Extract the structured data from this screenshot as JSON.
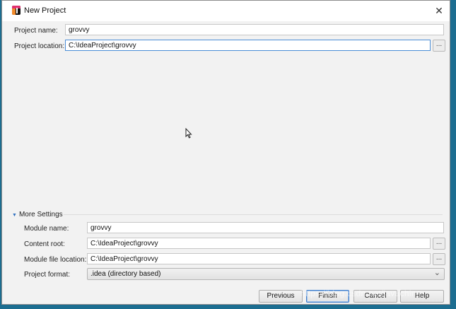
{
  "window": {
    "title": "New Project",
    "close_label": "✕"
  },
  "project": {
    "name_label": "Project name:",
    "name_value": "grovvy",
    "location_label": "Project location:",
    "location_value": "C:\\IdeaProject\\grovvy",
    "browse_label": "..."
  },
  "more_settings": {
    "header": "More Settings",
    "module_name_label": "Module name:",
    "module_name_value": "grovvy",
    "content_root_label": "Content root:",
    "content_root_value": "C:\\IdeaProject\\grovvy",
    "module_file_label": "Module file location:",
    "module_file_value": "C:\\IdeaProject\\grovvy",
    "project_format_label": "Project format:",
    "project_format_value": ".idea (directory based)",
    "browse_label": "..."
  },
  "buttons": {
    "previous": "Previous",
    "finish": "Finish",
    "cancel": "Cancel",
    "help": "Help"
  },
  "watermark": "https://blog.csdn.net/javachina",
  "icons": {
    "app": "intellij-idea-icon",
    "close": "close-icon",
    "expand": "triangle-down-icon",
    "dropdown": "chevron-down-icon"
  },
  "colors": {
    "focus_border": "#4a8dd6",
    "dialog_bg": "#f2f2f2",
    "desktop_bg": "#1c6d90"
  }
}
